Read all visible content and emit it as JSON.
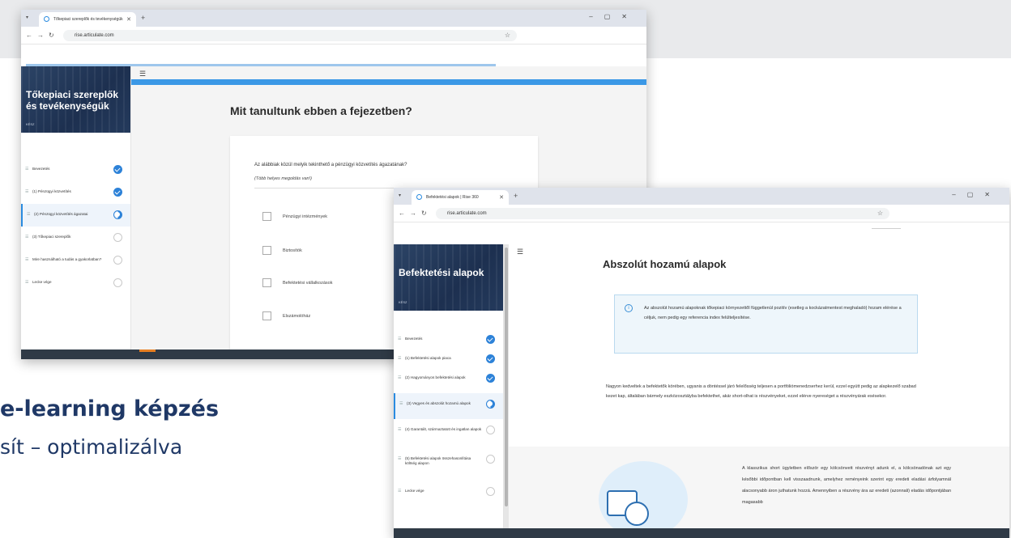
{
  "background_tagline": {
    "line1": "e-learning képzés",
    "line2": "sít – optimalizálva"
  },
  "window1": {
    "tab_title": "Tőkepiaci szereplők és tevékenységük",
    "url": "rise.articulate.com",
    "course_title": "Tőkepiaci szereplők és tevékenységük",
    "progress": "KÉSZ",
    "nav_items": [
      {
        "label": "Bevezetés",
        "status": "done"
      },
      {
        "label": "(1) Pénzügyi közvetítés",
        "status": "done"
      },
      {
        "label": "(2) Pénzügyi közvetítés ágazatai",
        "status": "in-progress"
      },
      {
        "label": "(3) Tőkepiaci szereplők",
        "status": "not-started"
      },
      {
        "label": "Mire használható a tudás a gyakorlatban?",
        "status": "not-started"
      },
      {
        "label": "Lecke vége",
        "status": "not-started"
      }
    ],
    "heading": "Mit tanultunk ebben a fejezetben?",
    "question": "Az alábbiak közül melyik tekinthető a pénzügyi közvetítés ágazatának?",
    "hint": "(Több helyes megoldás van!)",
    "options": [
      "Pénzügyi intézmények",
      "Biztosítók",
      "Befektetési vállalkozások",
      "Elszámolóház"
    ]
  },
  "window2": {
    "tab_title": "Befektetési alapok | Rise 360",
    "url": "rise.articulate.com",
    "course_title": "Befektetési alapok",
    "progress": "KÉSZ",
    "nav_items": [
      {
        "label": "Bevezetés",
        "status": "done"
      },
      {
        "label": "(1) Befektetési alapok piaca",
        "status": "done"
      },
      {
        "label": "(2) Hagyományos befektetési alapok",
        "status": "done"
      },
      {
        "label": "(3) Vegyes és abszolút hozamú alapok",
        "status": "in-progress"
      },
      {
        "label": "(4) Garantált, származtatott és ingatlan alapok",
        "status": "not-started"
      },
      {
        "label": "(5) Befektetési alapok összehasonlítása költség alapon",
        "status": "not-started"
      },
      {
        "label": "Lecke vége",
        "status": "not-started"
      }
    ],
    "heading": "Abszolút hozamú alapok",
    "note": "Az abszolút hozamú alapoknak tőkepiaci környezettől függetlenül pozitív (esetleg a kockázatmentest meghaladó) hozam elérése a céljuk, nem pedig egy referencia index felülteljesítése.",
    "paragraph": "Nagyon kedveltek a befektetők körében, ugyanis a döntéssel járó felelősség teljesen a portfóliómenedzserhez kerül, ezzel együtt pedig az alapkezelő szabad kezet kap, általában bármely eszközosztályba befektethet, akár short-olhat is részvényeket, ezzel elérve nyereséget a részvényárak esésekor.",
    "paragraph2": "A klasszikus short ügyletben először egy kölcsönvett részvényt adunk el, a kölcsönadónak azt egy későbbi időpontban kell visszaadnunk, amelyhez reményeink szerint egy eredeti eladási árfolyamnál alacsonyabb áron juthatunk hozzá. Amennyiben a részvény ára az eredeti (azonnali) eladás időpontjában magasabb"
  },
  "colors": {
    "accent": "#2d82d8",
    "hero": "#1d3050",
    "footer": "#2f3a46",
    "tagline": "#1f3866"
  }
}
